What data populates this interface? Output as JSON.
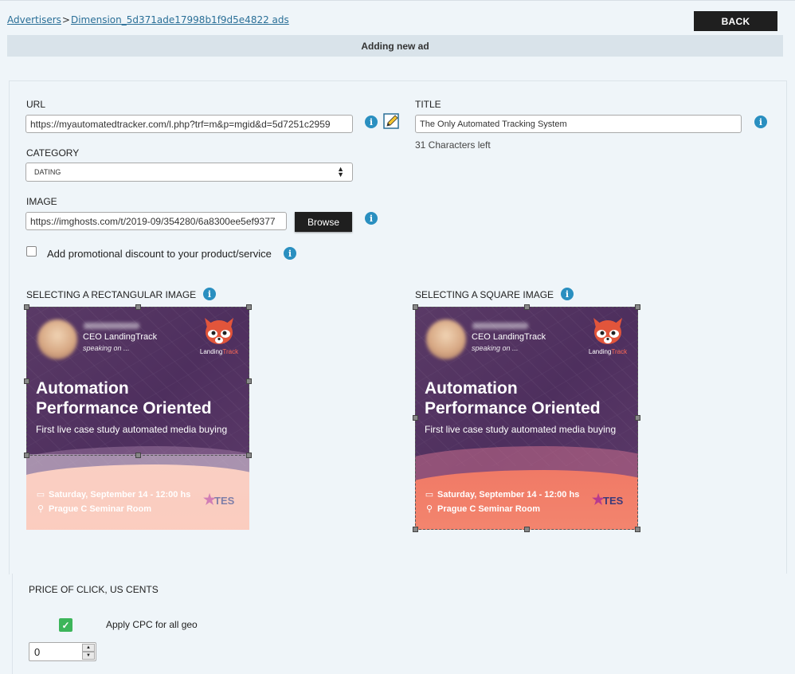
{
  "breadcrumb": {
    "root": "Advertisers",
    "separator": ">",
    "current": "Dimension_5d371ade17998b1f9d5e4822 ads"
  },
  "back_label": "BACK",
  "header_title": "Adding new ad",
  "form": {
    "url_label": "URL",
    "url_value": "https://myautomatedtracker.com/l.php?trf=m&p=mgid&d=5d7251c2959",
    "title_label": "TITLE",
    "title_value": "The Only Automated Tracking System",
    "chars_left": "31 Characters left",
    "category_label": "CATEGORY",
    "category_value": "DATING",
    "image_label": "IMAGE",
    "image_value": "https://imghosts.com/t/2019-09/354280/6a8300ee5ef9377",
    "browse_label": "Browse",
    "promo_label": "Add promotional discount to your product/service",
    "promo_checked": false
  },
  "image_select": {
    "rect_label": "SELECTING A RECTANGULAR IMAGE",
    "square_label": "SELECTING A SQUARE IMAGE"
  },
  "ad_creative": {
    "role": "CEO LandingTrack",
    "speaking": "speaking on ...",
    "logo_text_1": "Landing",
    "logo_text_2": "Track",
    "headline_1": "Automation",
    "headline_2": "Performance Oriented",
    "subtitle": "First live case study automated media buying",
    "date": "Saturday, September 14 - 12:00 hs",
    "location": "Prague C Seminar Room",
    "tes": "TES"
  },
  "pricing": {
    "title": "PRICE OF CLICK, US CENTS",
    "apply_cpc_label": "Apply CPC for all geo",
    "apply_cpc_checked": true,
    "value": "0"
  },
  "colors": {
    "dark_button": "#1f1f1f",
    "info_icon": "#2a8fc0",
    "check_green": "#3cb55a",
    "header_bar": "#d9e3ea"
  }
}
